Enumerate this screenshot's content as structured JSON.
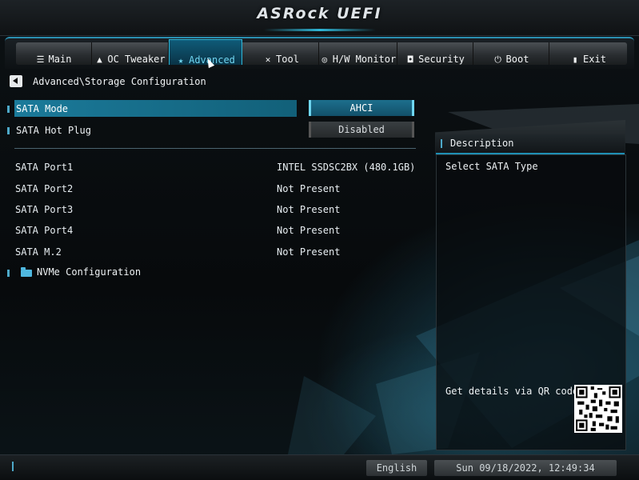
{
  "app": {
    "logo_text": "ASRock UEFI"
  },
  "tabs": [
    {
      "label": "Main",
      "icon": "list-icon"
    },
    {
      "label": "OC Tweaker",
      "icon": "flame-icon"
    },
    {
      "label": "Advanced",
      "icon": "star-icon",
      "active": true
    },
    {
      "label": "Tool",
      "icon": "tools-icon"
    },
    {
      "label": "H/W Monitor",
      "icon": "monitor-icon"
    },
    {
      "label": "Security",
      "icon": "shield-icon"
    },
    {
      "label": "Boot",
      "icon": "power-icon"
    },
    {
      "label": "Exit",
      "icon": "exit-icon"
    }
  ],
  "breadcrumb": "Advanced\\Storage Configuration",
  "settings": [
    {
      "label": "SATA Mode",
      "value": "AHCI",
      "selected": true
    },
    {
      "label": "SATA Hot Plug",
      "value": "Disabled"
    }
  ],
  "ports": [
    {
      "label": "SATA Port1",
      "value": "INTEL SSDSC2BX (480.1GB)"
    },
    {
      "label": "SATA Port2",
      "value": "Not Present"
    },
    {
      "label": "SATA Port3",
      "value": "Not Present"
    },
    {
      "label": "SATA Port4",
      "value": "Not Present"
    },
    {
      "label": "SATA M.2",
      "value": "Not Present"
    }
  ],
  "submenu": {
    "label": "NVMe Configuration",
    "icon": "folder-icon"
  },
  "description": {
    "title": "Description",
    "text": "Select SATA Type",
    "qr_text": "Get details via QR code"
  },
  "footer": {
    "language": "English",
    "datetime": "Sun 09/18/2022, 12:49:34"
  },
  "colors": {
    "accent": "#2fb7d8",
    "selected_row": "#1b7a9a"
  }
}
